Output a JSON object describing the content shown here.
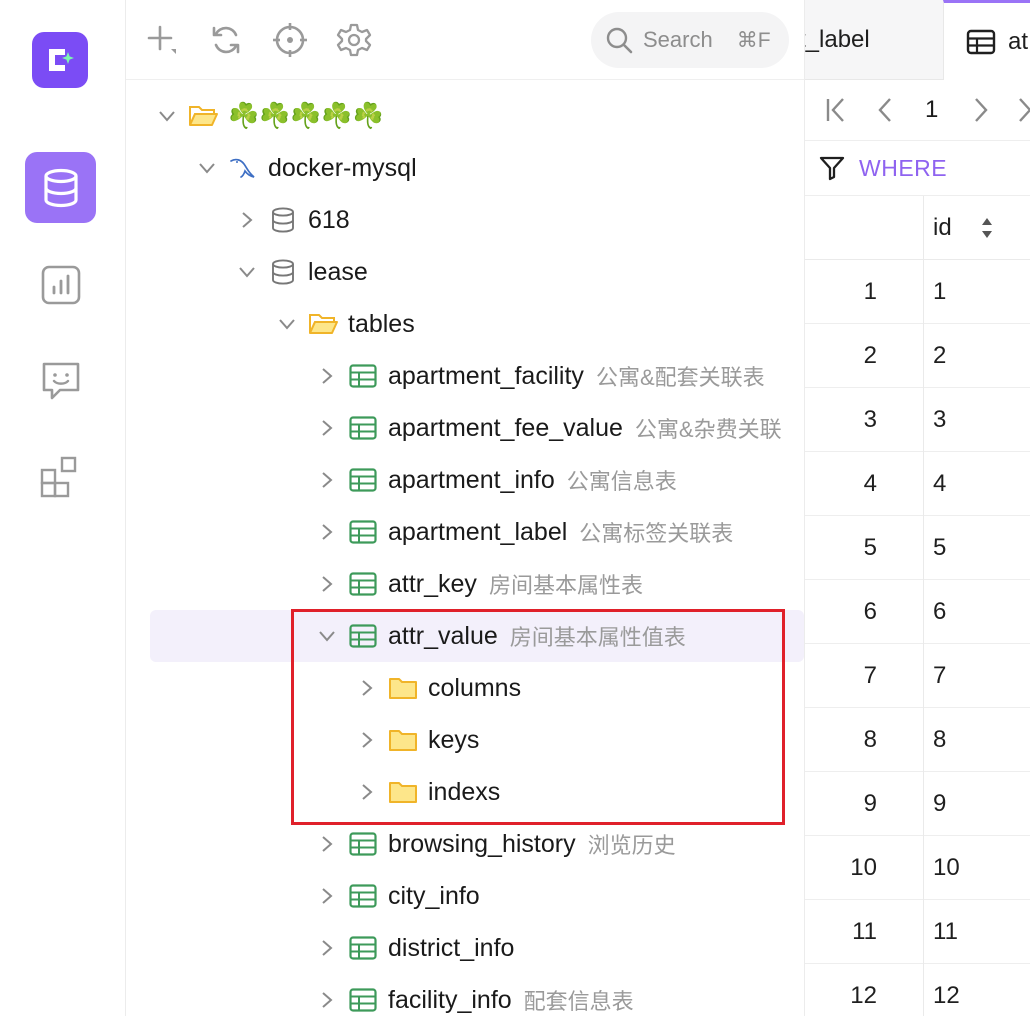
{
  "toolbar": {
    "search_placeholder": "Search",
    "search_shortcut": "⌘F"
  },
  "tree": {
    "group": {
      "label": "☘️☘️☘️☘️☘️"
    },
    "connection": {
      "label": "docker-mysql"
    },
    "databases": [
      {
        "label": "618"
      },
      {
        "label": "lease"
      }
    ],
    "tables_folder": {
      "label": "tables"
    },
    "tables_before": [
      {
        "name": "apartment_facility",
        "comment": "公寓&配套关联表"
      },
      {
        "name": "apartment_fee_value",
        "comment": "公寓&杂费关联"
      },
      {
        "name": "apartment_info",
        "comment": "公寓信息表"
      },
      {
        "name": "apartment_label",
        "comment": "公寓标签关联表"
      },
      {
        "name": "attr_key",
        "comment": "房间基本属性表"
      }
    ],
    "selected_table": {
      "name": "attr_value",
      "comment": "房间基本属性值表"
    },
    "selected_children": [
      {
        "label": "columns"
      },
      {
        "label": "keys"
      },
      {
        "label": "indexs"
      }
    ],
    "tables_after": [
      {
        "name": "browsing_history",
        "comment": "浏览历史"
      },
      {
        "name": "city_info",
        "comment": ""
      },
      {
        "name": "district_info",
        "comment": ""
      },
      {
        "name": "facility_info",
        "comment": "配套信息表"
      }
    ]
  },
  "grid": {
    "tab1_label": "t_label",
    "tab2_label": "at",
    "page_number": "1",
    "where_label": "WHERE",
    "column_header": "id",
    "rows": [
      {
        "n": "1",
        "id": "1"
      },
      {
        "n": "2",
        "id": "2"
      },
      {
        "n": "3",
        "id": "3"
      },
      {
        "n": "4",
        "id": "4"
      },
      {
        "n": "5",
        "id": "5"
      },
      {
        "n": "6",
        "id": "6"
      },
      {
        "n": "7",
        "id": "7"
      },
      {
        "n": "8",
        "id": "8"
      },
      {
        "n": "9",
        "id": "9"
      },
      {
        "n": "10",
        "id": "10"
      },
      {
        "n": "11",
        "id": "11"
      },
      {
        "n": "12",
        "id": "12"
      }
    ]
  },
  "colors": {
    "accent": "#9a73f6",
    "brand": "#7b4cf5",
    "table_icon": "#3d9a5a",
    "folder_icon": "#f5c542",
    "highlight_border": "#e0202a"
  },
  "icons": {
    "activity": [
      "database-icon",
      "chart-icon",
      "chat-icon",
      "apps-icon"
    ],
    "toolbar": [
      "add-icon",
      "refresh-icon",
      "locate-icon",
      "settings-icon",
      "search-icon"
    ]
  }
}
